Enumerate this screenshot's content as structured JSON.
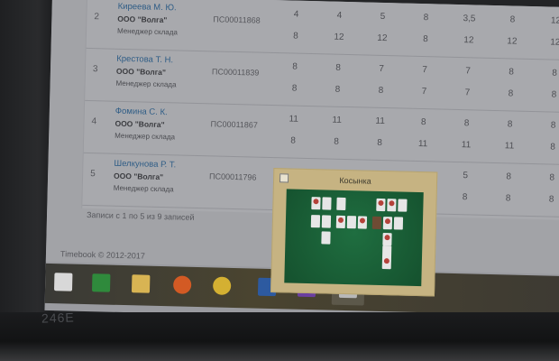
{
  "table": {
    "rows": [
      {
        "num": "2",
        "name": "Киреева М. Ю.",
        "org": "ООО \"Волга\"",
        "role": "Менеджер склада",
        "code": "ПС00011868",
        "top": [
          "4",
          "4",
          "5",
          "8",
          "3,5",
          "8",
          "12"
        ],
        "bottom": [
          "8",
          "12",
          "12",
          "8",
          "12",
          "12",
          "12"
        ]
      },
      {
        "num": "3",
        "name": "Крестова Т. Н.",
        "org": "ООО \"Волга\"",
        "role": "Менеджер склада",
        "code": "ПС00011839",
        "top": [
          "8",
          "8",
          "7",
          "7",
          "7",
          "8",
          "8"
        ],
        "bottom": [
          "8",
          "8",
          "8",
          "7",
          "7",
          "8",
          "8"
        ]
      },
      {
        "num": "4",
        "name": "Фомина С. К.",
        "org": "ООО \"Волга\"",
        "role": "Менеджер склада",
        "code": "ПС00011867",
        "top": [
          "11",
          "11",
          "11",
          "8",
          "8",
          "8",
          "8"
        ],
        "bottom": [
          "8",
          "8",
          "8",
          "11",
          "11",
          "11",
          "8"
        ]
      },
      {
        "num": "5",
        "name": "Шелкунова Р. Т.",
        "org": "ООО \"Волга\"",
        "role": "Менеджер склада",
        "code": "ПС00011796",
        "top": [
          "",
          "",
          "",
          "",
          "5",
          "8",
          "8"
        ],
        "bottom": [
          "",
          "",
          "",
          "",
          "8",
          "8",
          "8"
        ]
      }
    ],
    "records_info": "Записи с 1 по 5 из 9 записей"
  },
  "footer": {
    "copyright": "Timebook © 2012-2017"
  },
  "preview": {
    "title": "Косынка"
  },
  "taskbar": {
    "items": [
      {
        "name": "windows-start-icon",
        "color": "#d8d8d8"
      },
      {
        "name": "store-icon",
        "color": "#2f8a3c"
      },
      {
        "name": "file-explorer-icon",
        "color": "#d8b453"
      },
      {
        "name": "browser-icon",
        "color": "#d35a24"
      },
      {
        "name": "chrome-icon",
        "color": "#d4b032"
      },
      {
        "name": "word-icon",
        "color": "#2d5aa0"
      },
      {
        "name": "search-app-icon",
        "color": "#6b3fa0"
      },
      {
        "name": "solitaire-icon",
        "color": "#b8b8b8"
      }
    ]
  },
  "monitor": {
    "model": "246E"
  }
}
